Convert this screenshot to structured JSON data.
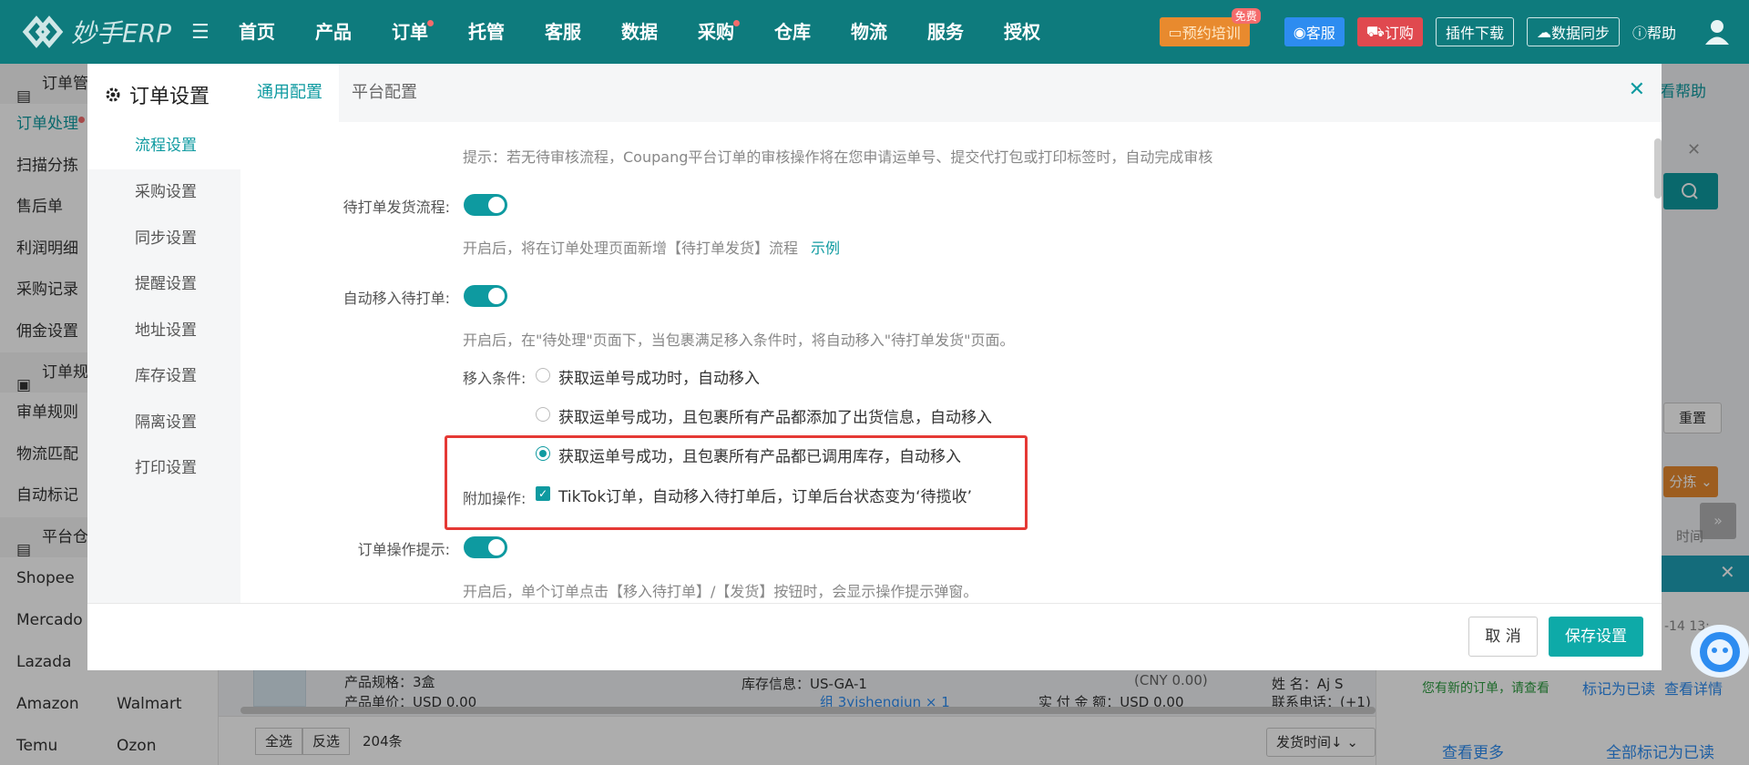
{
  "app": {
    "logo_text": "妙手ERP"
  },
  "nav": {
    "items": [
      {
        "label": "首页",
        "dot": false
      },
      {
        "label": "产品",
        "dot": false
      },
      {
        "label": "订单",
        "dot": true
      },
      {
        "label": "托管",
        "dot": false
      },
      {
        "label": "客服",
        "dot": false
      },
      {
        "label": "数据",
        "dot": false
      },
      {
        "label": "采购",
        "dot": true
      },
      {
        "label": "仓库",
        "dot": false
      },
      {
        "label": "物流",
        "dot": false
      },
      {
        "label": "服务",
        "dot": false
      },
      {
        "label": "授权",
        "dot": false
      }
    ],
    "train_label": "预约培训",
    "train_badge": "免费",
    "service_label": "客服",
    "order_label": "订购",
    "plugin_label": "插件下载",
    "sync_label": "数据同步",
    "help_label": "帮助"
  },
  "sidebar": {
    "group1": "订单管",
    "items1": [
      "订单处理",
      "扫描分拣",
      "售后单",
      "利润明细",
      "采购记录",
      "佣金设置"
    ],
    "group2": "订单规",
    "items2": [
      "审单规则",
      "物流匹配",
      "自动标记"
    ],
    "group3": "平台仓",
    "platforms": [
      [
        "Shopee",
        ""
      ],
      [
        "Mercado",
        ""
      ],
      [
        "Lazada",
        ""
      ],
      [
        "Amazon",
        "Walmart"
      ],
      [
        "Temu",
        "Ozon"
      ]
    ]
  },
  "background": {
    "help_link": "看帮助",
    "reset": "重置",
    "orange_btn": "分拣",
    "time": "时间",
    "notify_date": "-14 13:",
    "notify_msg": "您有新的订单，请查看",
    "notify_mark": "标记为已读",
    "notify_detail": "查看详情",
    "notify_more": "查看更多",
    "notify_markall": "全部标记为已读",
    "order": {
      "spec": "产品规格：3盒",
      "price": "产品单价：USD 0.00",
      "stock": "库存信息：US-GA-1",
      "combo": "组  3yishengjun ×  1",
      "cny": "(CNY 0.00)",
      "paid": "实 付 金 额：USD 0.00",
      "name": "姓      名：Aj S",
      "phone": "联系电话：(+1)"
    },
    "footer": {
      "select_all": "全选",
      "invert": "反选",
      "count": "204条",
      "sort": "发货时间↓"
    }
  },
  "modal": {
    "title": "订单设置",
    "tabs": [
      "通用配置",
      "平台配置"
    ],
    "menu": [
      "流程设置",
      "采购设置",
      "同步设置",
      "提醒设置",
      "地址设置",
      "库存设置",
      "隔离设置",
      "打印设置"
    ],
    "hint_top": "提示：若无待审核流程，Coupang平台订单的审核操作将在您申请运单号、提交代打包或打印标签时，自动完成审核",
    "print_flow": {
      "label": "待打单发货流程:",
      "hint": "开启后，将在订单处理页面新增【待打单发货】流程",
      "link": "示例"
    },
    "auto_move": {
      "label": "自动移入待打单:",
      "hint": "开启后，在\"待处理\"页面下，当包裹满足移入条件时，将自动移入\"待打单发货\"页面。",
      "cond_label": "移入条件:",
      "options": [
        "获取运单号成功时，自动移入",
        "获取运单号成功，且包裹所有产品都添加了出货信息，自动移入",
        "获取运单号成功，且包裹所有产品都已调用库存，自动移入"
      ],
      "extra_label": "附加操作:",
      "extra_text": "TikTok订单，自动移入待打单后，订单后台状态变为‘待揽收’"
    },
    "op_tip": {
      "label": "订单操作提示:",
      "hint": "开启后，单个订单点击【移入待打单】/【发货】按钮时，会显示操作提示弹窗。"
    },
    "cancel": "取 消",
    "save": "保存设置"
  },
  "colors": {
    "primary": "#0e9aa0",
    "nav_bg": "#0e7b7d",
    "highlight": "#e53935"
  }
}
